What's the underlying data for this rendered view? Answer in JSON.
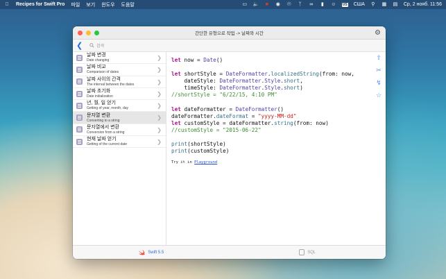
{
  "menubar": {
    "menus": [
      "Recipes for Swift Pro",
      "파일",
      "보기",
      "윈도우",
      "도움말"
    ],
    "keyboard_layout": "США",
    "clock": "Ср, 2 нояб. 11:56",
    "status_icons": [
      "screen-icon",
      "mute-icon",
      "red-app-icon",
      "vpn-icon",
      "globe-icon",
      "bluetooth-icon",
      "link-icon",
      "battery-icon",
      "user-icon",
      "search-icon",
      "control-center-icon",
      "menu-extra-icon"
    ]
  },
  "window": {
    "title": "간단한 유형으로 작업 -> 날짜와 시간",
    "search_placeholder": "검색"
  },
  "sidebar": {
    "items": [
      {
        "ko": "날짜 변경",
        "en": "Date changing"
      },
      {
        "ko": "날짜 비교",
        "en": "Comparison of dates"
      },
      {
        "ko": "날짜 사이의 간격",
        "en": "The interval between the dates"
      },
      {
        "ko": "날짜 초기화",
        "en": "Date initialization"
      },
      {
        "ko": "년, 월, 일 얻기",
        "en": "Getting of year, month, day"
      },
      {
        "ko": "문자열 변환",
        "en": "Converting to a string"
      },
      {
        "ko": "문자열에서 변환",
        "en": "Conversion from a string"
      },
      {
        "ko": "현재 날짜 얻기",
        "en": "Getting of the current date"
      }
    ],
    "selected_index": 5
  },
  "code": {
    "lines": [
      [
        {
          "c": "kw",
          "t": "let"
        },
        {
          "c": "",
          "t": " now = "
        },
        {
          "c": "ty",
          "t": "Date"
        },
        {
          "c": "",
          "t": "()"
        }
      ],
      [],
      [
        {
          "c": "kw",
          "t": "let"
        },
        {
          "c": "",
          "t": " shortStyle = "
        },
        {
          "c": "ty",
          "t": "DateFormatter"
        },
        {
          "c": "",
          "t": "."
        },
        {
          "c": "me",
          "t": "localizedString"
        },
        {
          "c": "",
          "t": "(from: now,"
        }
      ],
      [
        {
          "c": "",
          "t": "    dateStyle: "
        },
        {
          "c": "ty",
          "t": "DateFormatter"
        },
        {
          "c": "",
          "t": "."
        },
        {
          "c": "ty",
          "t": "Style"
        },
        {
          "c": "",
          "t": "."
        },
        {
          "c": "me",
          "t": "short"
        },
        {
          "c": "",
          "t": ","
        }
      ],
      [
        {
          "c": "",
          "t": "    timeStyle: "
        },
        {
          "c": "ty",
          "t": "DateFormatter"
        },
        {
          "c": "",
          "t": "."
        },
        {
          "c": "ty",
          "t": "Style"
        },
        {
          "c": "",
          "t": "."
        },
        {
          "c": "me",
          "t": "short"
        },
        {
          "c": "",
          "t": ")"
        }
      ],
      [
        {
          "c": "cm",
          "t": "//shortStyle = \"6/22/15, 4:10 PM\""
        }
      ],
      [],
      [
        {
          "c": "kw",
          "t": "let"
        },
        {
          "c": "",
          "t": " dateFormatter = "
        },
        {
          "c": "ty",
          "t": "DateFormatter"
        },
        {
          "c": "",
          "t": "()"
        }
      ],
      [
        {
          "c": "",
          "t": "dateFormatter."
        },
        {
          "c": "me",
          "t": "dateFormat"
        },
        {
          "c": "",
          "t": " = "
        },
        {
          "c": "st",
          "t": "\"yyyy-MM-dd\""
        }
      ],
      [
        {
          "c": "kw",
          "t": "let"
        },
        {
          "c": "",
          "t": " customStyle = dateFormatter."
        },
        {
          "c": "me",
          "t": "string"
        },
        {
          "c": "",
          "t": "(from: now)"
        }
      ],
      [
        {
          "c": "cm",
          "t": "//customStyle = \"2015-06-22\""
        }
      ],
      [],
      [
        {
          "c": "me",
          "t": "print"
        },
        {
          "c": "",
          "t": "(shortStyle)"
        }
      ],
      [
        {
          "c": "me",
          "t": "print"
        },
        {
          "c": "",
          "t": "(customStyle)"
        }
      ]
    ],
    "try_prefix": "Try it in ",
    "try_link": "Playground"
  },
  "side_actions": [
    "share-icon",
    "scissors-icon",
    "sort-icon",
    "star-icon"
  ],
  "bottom_tabs": [
    {
      "label": "Swift 5.5",
      "icon": "swift-icon",
      "active": true
    },
    {
      "label": "SQL",
      "icon": "database-icon",
      "active": false
    }
  ]
}
